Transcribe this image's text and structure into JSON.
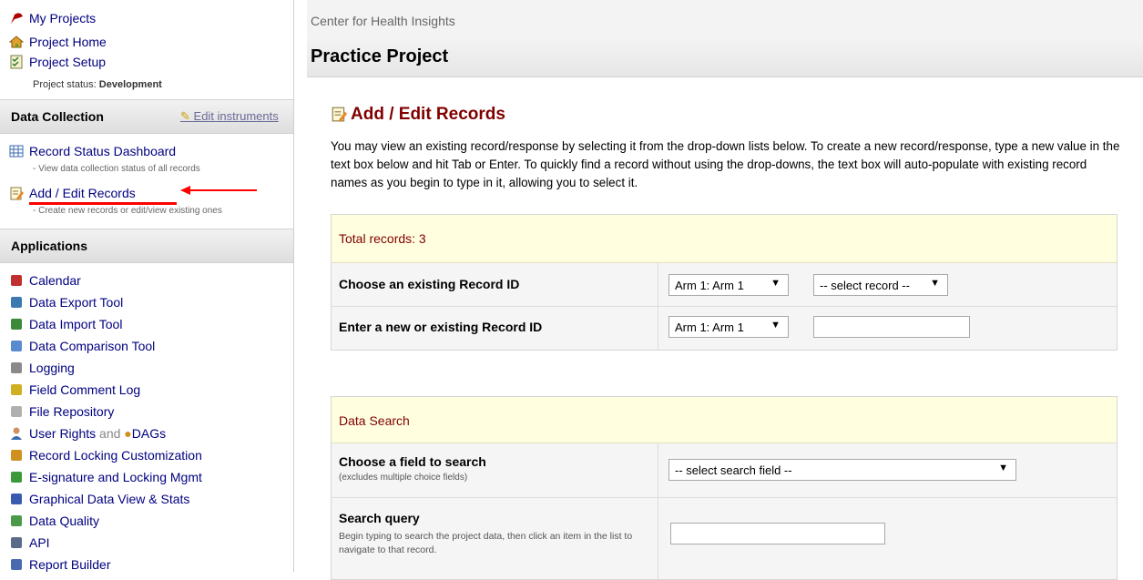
{
  "sidebar": {
    "nav": {
      "my_projects": "My Projects",
      "project_home": "Project Home",
      "project_setup": "Project Setup",
      "status_label": "Project status:",
      "status_value": "Development"
    },
    "data_collection": {
      "header": "Data Collection",
      "edit_instruments": "Edit instruments",
      "items": [
        {
          "label": "Record Status Dashboard",
          "sub": "- View data collection status of all records"
        },
        {
          "label": "Add / Edit Records",
          "sub": "- Create new records or edit/view existing ones"
        }
      ]
    },
    "applications": {
      "header": "Applications",
      "items": [
        {
          "label": "Calendar",
          "icon": "calendar-icon"
        },
        {
          "label": "Data Export Tool",
          "icon": "export-icon"
        },
        {
          "label": "Data Import Tool",
          "icon": "import-icon"
        },
        {
          "label": "Data Comparison Tool",
          "icon": "compare-icon"
        },
        {
          "label": "Logging",
          "icon": "logging-icon"
        },
        {
          "label": "Field Comment Log",
          "icon": "comment-icon"
        },
        {
          "label": "File Repository",
          "icon": "files-icon"
        },
        {
          "label": "Record Locking Customization",
          "icon": "lock-icon"
        },
        {
          "label": "E-signature and Locking Mgmt",
          "icon": "esign-icon"
        },
        {
          "label": "Graphical Data View & Stats",
          "icon": "chart-icon"
        },
        {
          "label": "Data Quality",
          "icon": "quality-icon"
        },
        {
          "label": "API",
          "icon": "api-icon"
        },
        {
          "label": "Report Builder",
          "icon": "report-icon"
        }
      ],
      "user_rights": {
        "label": "User Rights",
        "and": "and",
        "dags": "DAGs"
      }
    }
  },
  "main": {
    "org": "Center for Health Insights",
    "project_title": "Practice Project",
    "page_title": "Add / Edit Records",
    "intro": "You may view an existing record/response by selecting it from the drop-down lists below. To create a new record/response, type a new value in the text box below and hit Tab or Enter. To quickly find a record without using the drop-downs, the text box will auto-populate with existing record names as you begin to type in it, allowing you to select it.",
    "records_panel": {
      "total": "Total records: 3",
      "choose_label": "Choose an existing Record ID",
      "enter_label": "Enter a new or existing Record ID",
      "arm_value": "Arm 1: Arm 1",
      "record_select": "-- select record --"
    },
    "search_panel": {
      "header": "Data Search",
      "field_label": "Choose a field to search",
      "field_note": "(excludes multiple choice fields)",
      "field_select": "-- select search field --",
      "query_label": "Search query",
      "query_note": "Begin typing to search the project data, then click an item in the list to navigate to that record."
    }
  },
  "colors": {
    "link": "#000080",
    "accent": "#800000",
    "highlight_arrow": "#ff0000",
    "panel_head": "#ffffe0"
  }
}
